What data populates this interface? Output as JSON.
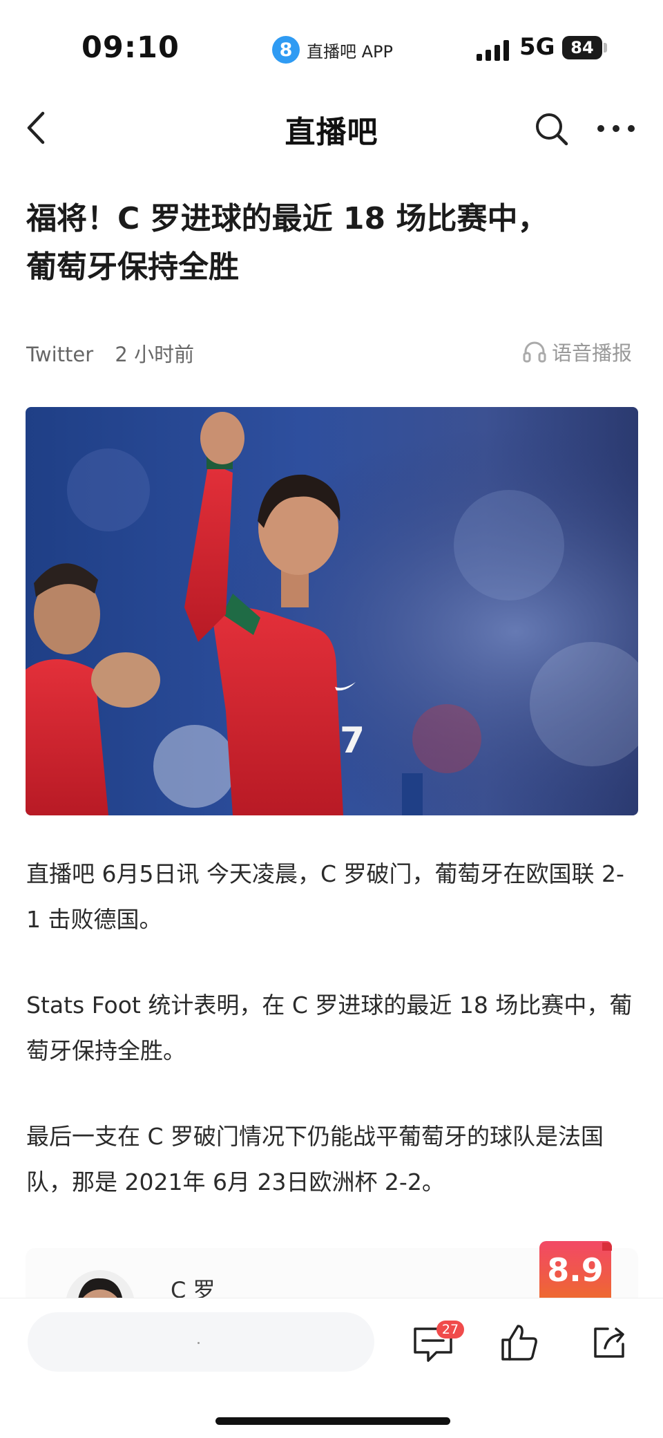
{
  "status_bar": {
    "time": "09:10",
    "app_logo_glyph": "8",
    "app_name": "直播吧 APP",
    "network": "5G",
    "battery": "84"
  },
  "nav": {
    "title": "直播吧",
    "back_icon": "chevron-left-icon",
    "search_icon": "search-icon",
    "more_icon": "more-icon"
  },
  "article": {
    "title_line1": "福将！C 罗进球的最近 18 场比赛中，",
    "title_line2": "葡萄牙保持全胜",
    "source": "Twitter",
    "time": "2 小时前",
    "audio_label": "语音播报",
    "paragraphs": [
      "直播吧 6月5日讯  今天凌晨，C 罗破门，葡萄牙在欧国联 2-1 击败德国。",
      "Stats   Foot 统计表明，在 C 罗进球的最近 18 场比赛中，葡萄牙保持全胜。",
      "最后一支在 C 罗破门情况下仍能战平葡萄牙的球队是法国队，那是 2021年 6月 23日欧洲杯 2-2。"
    ]
  },
  "player_card": {
    "name": "C 罗",
    "rating": "8.9"
  },
  "bottom_bar": {
    "comment_placeholder": "",
    "comment_count": "27"
  },
  "colors": {
    "accent_blue": "#2f9bf3",
    "badge_red": "#f04b4b",
    "rating_gradient_start": "#f24966",
    "rating_gradient_end": "#ee6a30"
  }
}
